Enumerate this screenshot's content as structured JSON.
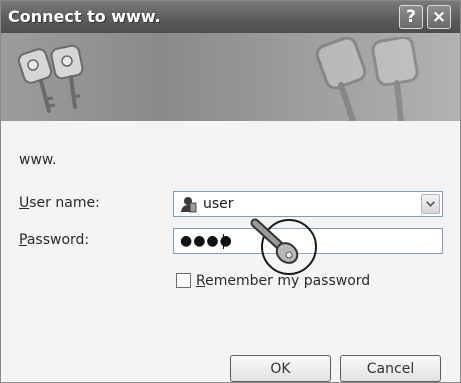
{
  "window": {
    "title": "Connect to www.",
    "help_label": "?",
    "close_label": "×"
  },
  "dialog": {
    "site_label": "www.",
    "username": {
      "label_access_key": "U",
      "label_rest": "ser name:",
      "value": "user"
    },
    "password": {
      "label_access_key": "P",
      "label_rest": "assword:",
      "masked_value": "●●●●"
    },
    "remember": {
      "label_access_key": "R",
      "label_rest": "emember my password",
      "checked": false
    },
    "buttons": {
      "ok": "OK",
      "cancel": "Cancel"
    }
  },
  "icons": {
    "banner": "keys-icon",
    "user": "user-icon",
    "dropdown": "chevron-down-icon",
    "cursor": "key-cursor-icon"
  }
}
